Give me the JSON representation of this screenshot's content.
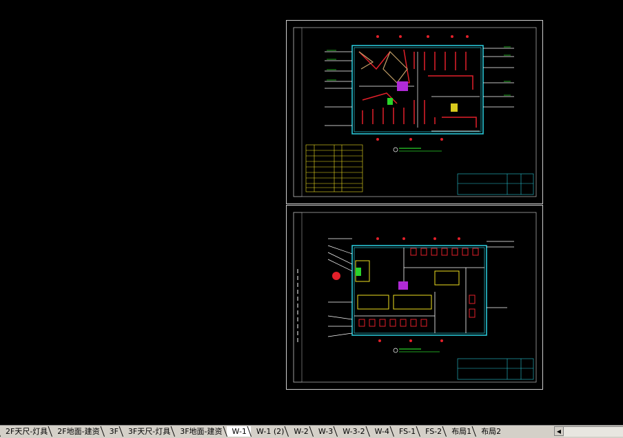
{
  "layout_tabs": [
    {
      "label": "2F天尺-灯具",
      "active": false
    },
    {
      "label": "2F地面-建资",
      "active": false
    },
    {
      "label": "3F",
      "active": false
    },
    {
      "label": "3F天尺-灯具",
      "active": false
    },
    {
      "label": "3F地面-建资",
      "active": false
    },
    {
      "label": "W-1",
      "active": true
    },
    {
      "label": "W-1 (2)",
      "active": false
    },
    {
      "label": "W-2",
      "active": false
    },
    {
      "label": "W-3",
      "active": false
    },
    {
      "label": "W-3-2",
      "active": false
    },
    {
      "label": "W-4",
      "active": false
    },
    {
      "label": "FS-1",
      "active": false
    },
    {
      "label": "FS-2",
      "active": false
    },
    {
      "label": "布局1",
      "active": false
    },
    {
      "label": "布局2",
      "active": false
    }
  ],
  "scroll": {
    "left_arrow": "◀"
  },
  "colors": {
    "background": "#000000",
    "sheet_border": "#cfcfcf",
    "wall_cyan": "#29c6d6",
    "wall_red": "#e3202a",
    "label_white": "#ffffff",
    "legend_yellow": "#f0e020",
    "accent_green": "#2ad42a",
    "accent_magenta": "#b02ad6",
    "tab_bar": "#d4d0c8"
  }
}
